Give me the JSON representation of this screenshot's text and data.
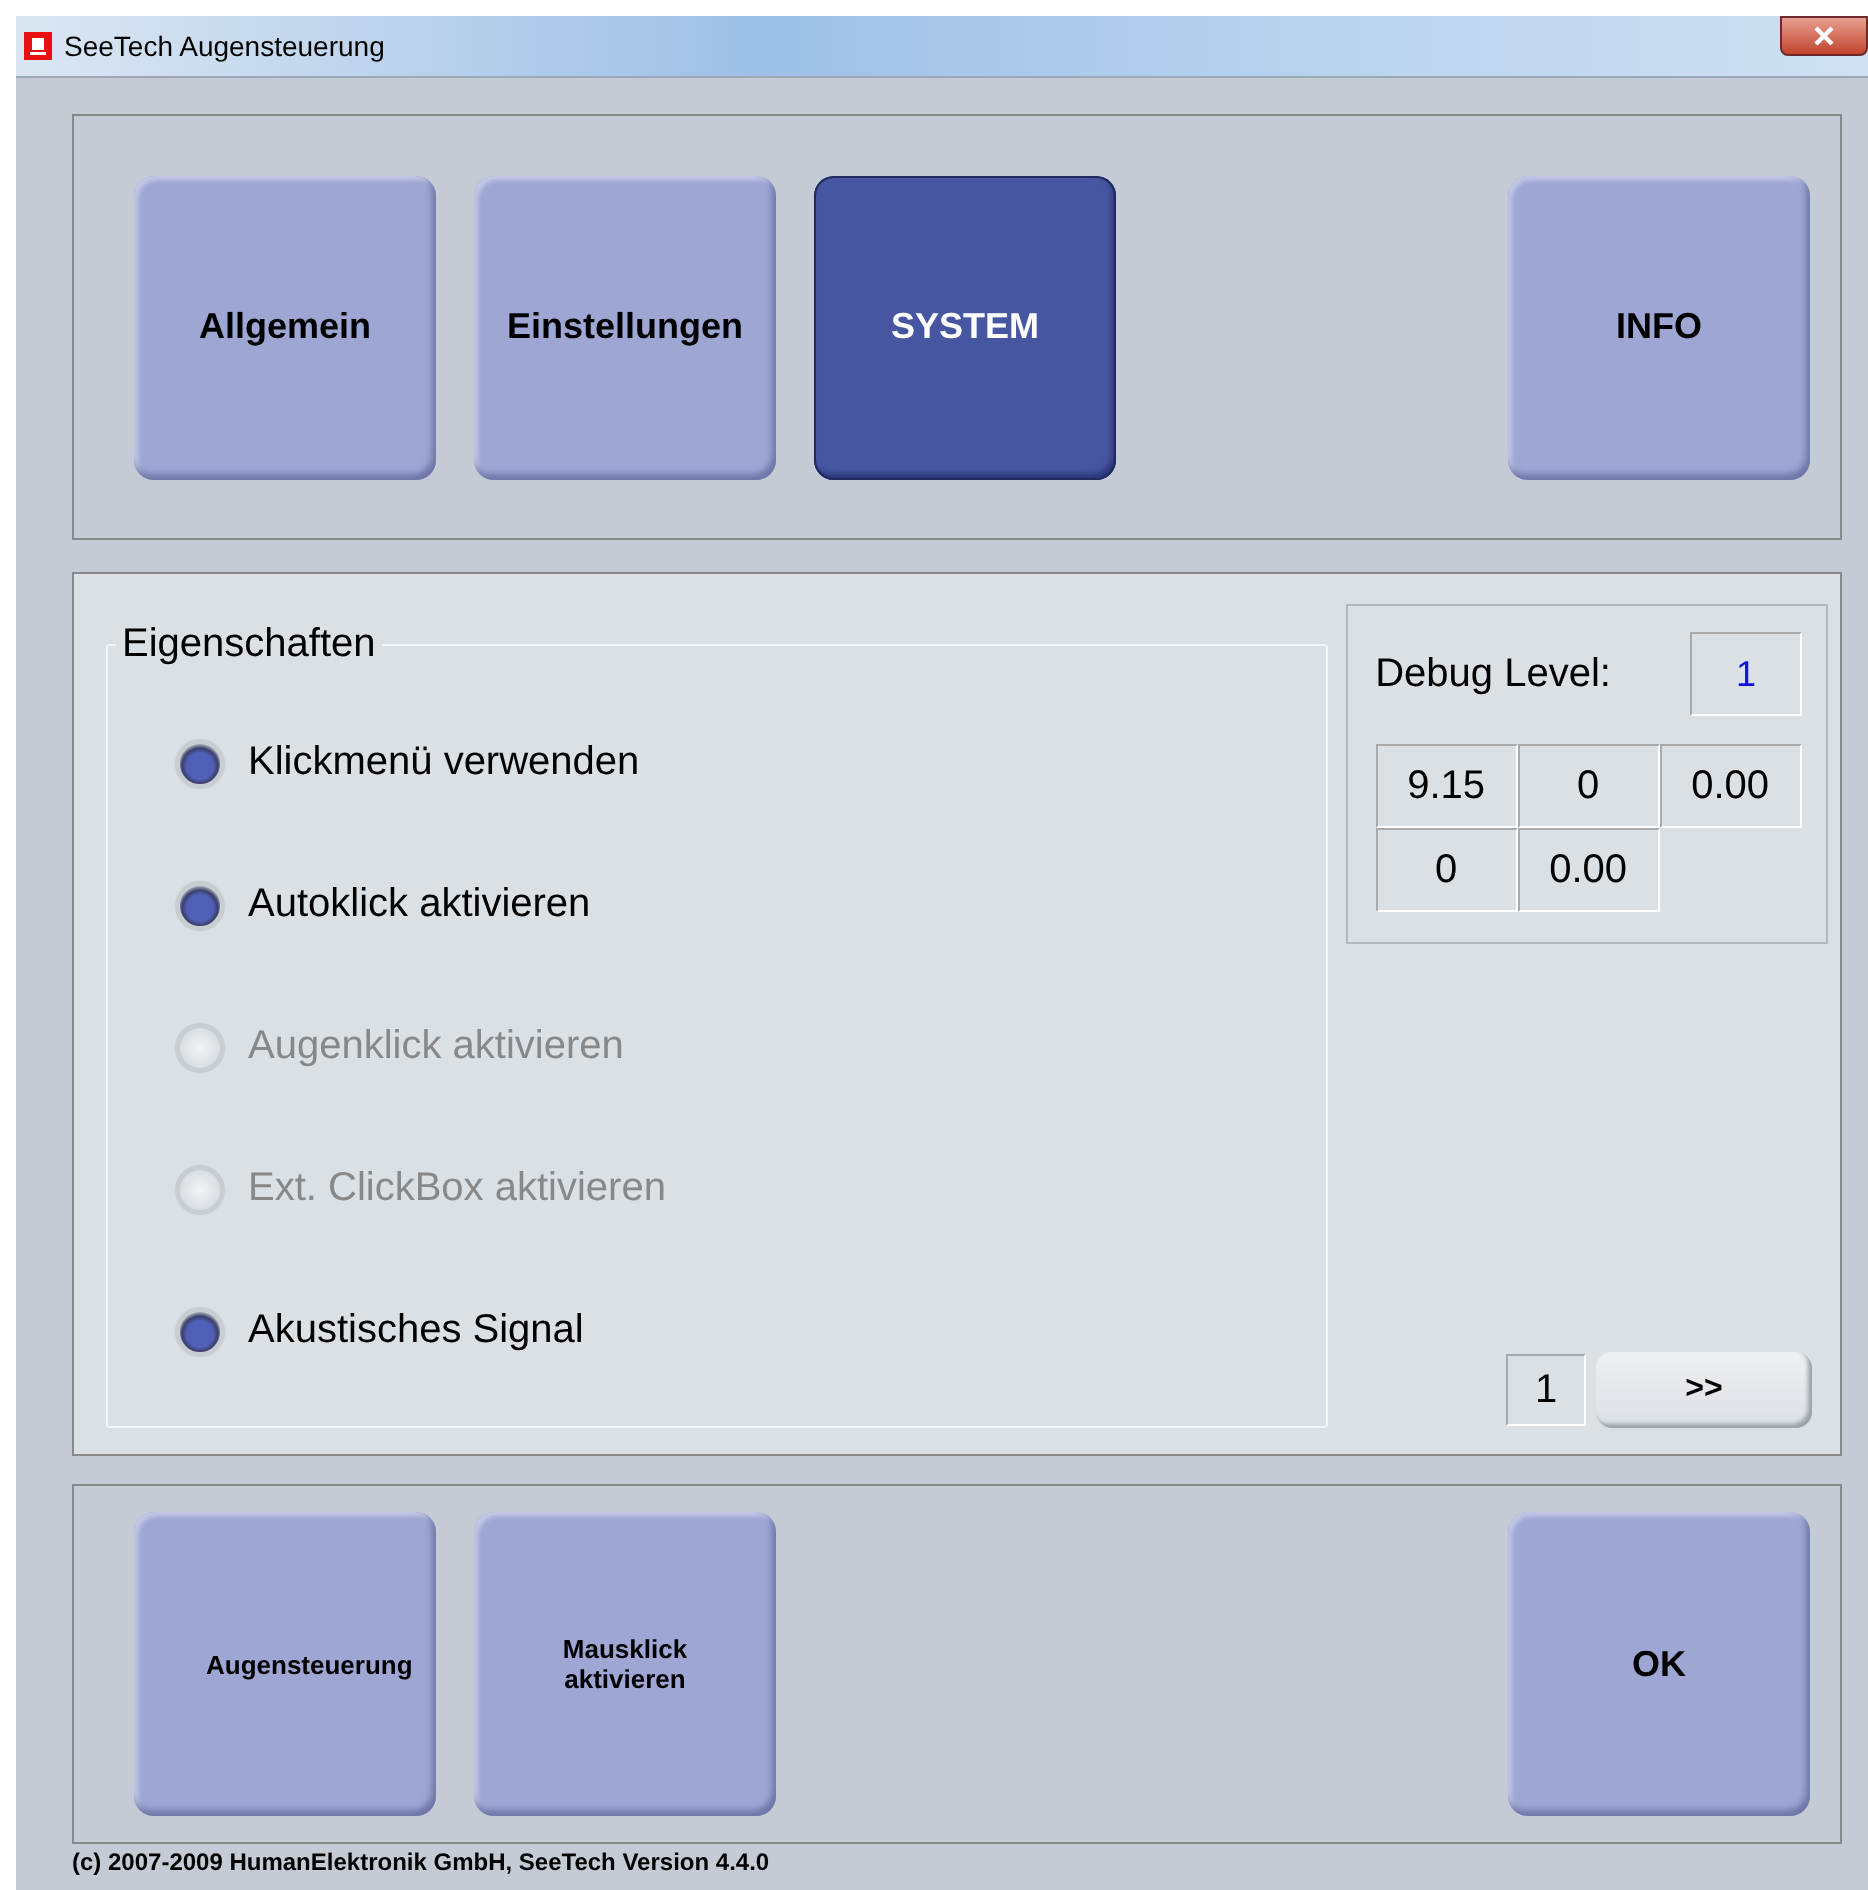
{
  "window": {
    "title": "SeeTech Augensteuerung"
  },
  "tabs": [
    {
      "label": "Allgemein",
      "selected": false
    },
    {
      "label": "Einstellungen",
      "selected": false
    },
    {
      "label": "SYSTEM",
      "selected": true
    },
    {
      "label": "INFO",
      "selected": false
    }
  ],
  "properties": {
    "title": "Eigenschaften",
    "options": [
      {
        "label": "Klickmenü verwenden",
        "checked": true,
        "disabled": false
      },
      {
        "label": "Autoklick aktivieren",
        "checked": true,
        "disabled": false
      },
      {
        "label": "Augenklick aktivieren",
        "checked": false,
        "disabled": true
      },
      {
        "label": "Ext. ClickBox aktivieren",
        "checked": false,
        "disabled": true
      },
      {
        "label": "Akustisches Signal",
        "checked": true,
        "disabled": false
      }
    ]
  },
  "debug": {
    "label": "Debug Level:",
    "value": "1",
    "rows": [
      [
        "9.15",
        "0",
        "0.00"
      ],
      [
        "0",
        "0.00"
      ]
    ]
  },
  "pager": {
    "page": "1",
    "next": ">>"
  },
  "bottom_buttons": [
    "Augensteuerung",
    "Mausklick aktivieren"
  ],
  "ok_button": "OK",
  "status_bar": "(c) 2007-2009 HumanElektronik GmbH, SeeTech Version 4.4.0"
}
